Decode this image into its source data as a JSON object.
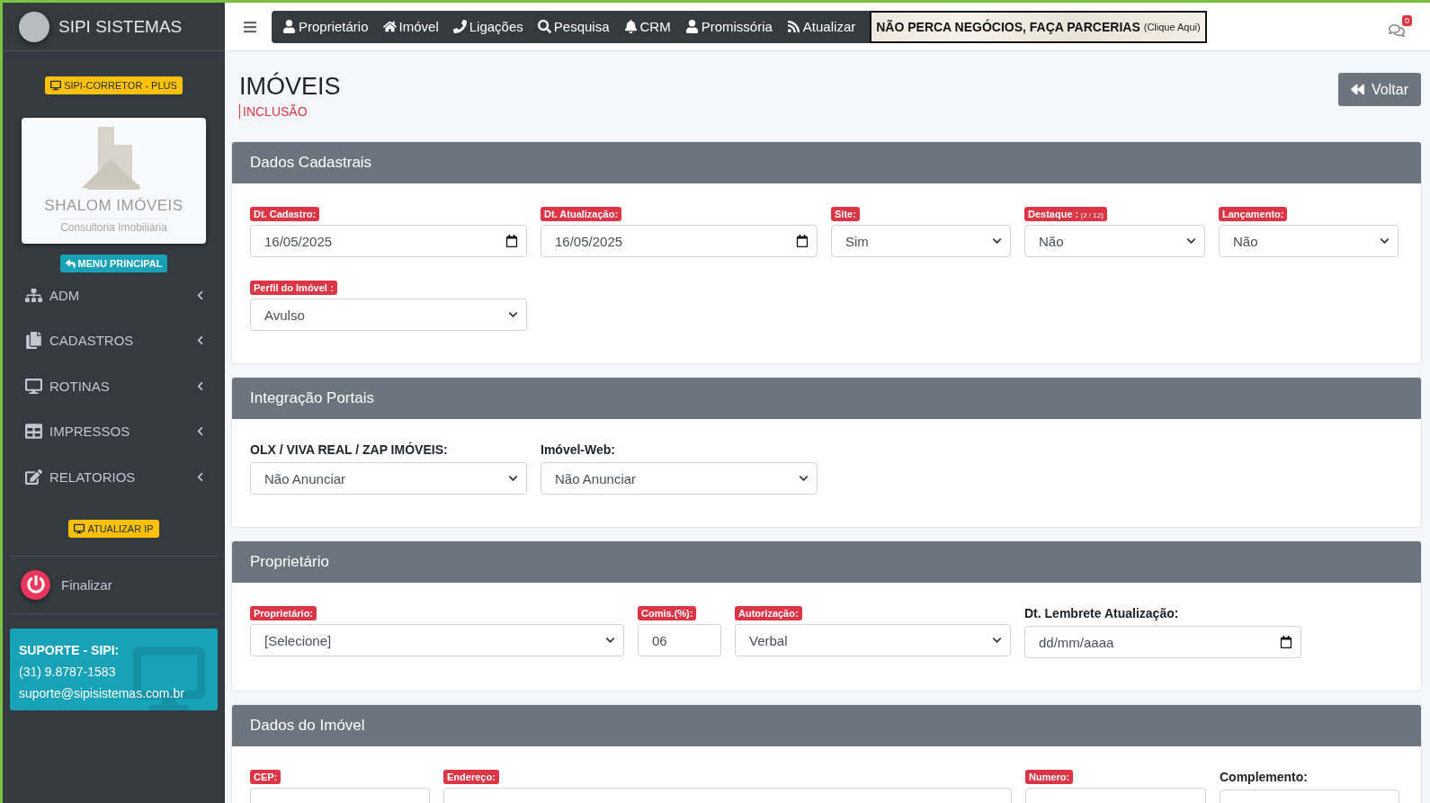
{
  "sidebar": {
    "brand": "SIPI SISTEMAS",
    "plan_badge": "SIPI-CORRETOR - PLUS",
    "logo": {
      "title": "SHALOM IMÓVEIS",
      "subtitle": "Consultoria Imobiliária"
    },
    "menu_button": "MENU PRINCIPAL",
    "items": [
      {
        "label": "ADM"
      },
      {
        "label": "CADASTROS"
      },
      {
        "label": "ROTINAS"
      },
      {
        "label": "IMPRESSOS"
      },
      {
        "label": "RELATORIOS"
      }
    ],
    "update_ip": "ATUALIZAR IP",
    "logout": "Finalizar",
    "support": {
      "title": "SUPORTE - SIPI:",
      "phone": "(31) 9.8787-1583",
      "email": "suporte@sipisistemas.com.br"
    }
  },
  "topnav": {
    "items": [
      {
        "label": "Proprietário"
      },
      {
        "label": "Imóvel"
      },
      {
        "label": "Ligações"
      },
      {
        "label": "Pesquisa"
      },
      {
        "label": "CRM"
      },
      {
        "label": "Promissória"
      },
      {
        "label": "Atualizar"
      }
    ],
    "banner": {
      "text": "NÃO PERCA NEGÓCIOS, FAÇA PARCERIAS",
      "hint": "(Clique Aqui)"
    },
    "notifications": "0"
  },
  "page": {
    "title": "IMÓVEIS",
    "subtitle": "INCLUSÃO",
    "back_button": "Voltar"
  },
  "sections": [
    {
      "title": "Dados Cadastrais",
      "rows": [
        [
          {
            "label": "Dt. Cadastro:",
            "required": true,
            "kind": "date",
            "value": "16/05/2025"
          },
          {
            "label": "Dt. Atualização:",
            "required": true,
            "kind": "date",
            "value": "16/05/2025"
          },
          {
            "label": "Site:",
            "required": true,
            "kind": "select",
            "value": "Sim"
          },
          {
            "label": "Destaque :",
            "note": "(2 / 12)",
            "required": true,
            "kind": "select",
            "value": "Não"
          },
          {
            "label": "Lançamento:",
            "required": true,
            "kind": "select",
            "value": "Não"
          }
        ],
        [
          {
            "label": "Perfil do Imóvel :",
            "required": true,
            "kind": "select",
            "value": "Avulso"
          }
        ]
      ]
    },
    {
      "title": "Integração Portais",
      "rows": [
        [
          {
            "label": "OLX / VIVA REAL / ZAP IMÓVEIS:",
            "required": false,
            "kind": "select",
            "value": "Não Anunciar"
          },
          {
            "label": "Imóvel-Web:",
            "required": false,
            "kind": "select",
            "value": "Não Anunciar"
          }
        ]
      ]
    },
    {
      "title": "Proprietário",
      "rows": [
        [
          {
            "label": "Proprietário:",
            "required": true,
            "kind": "select",
            "value": "[Selecione]"
          },
          {
            "label": "Comis.(%):",
            "required": true,
            "kind": "text",
            "value": "06"
          },
          {
            "label": "Autorização:",
            "required": true,
            "kind": "select",
            "value": "Verbal"
          },
          {
            "label": "Dt. Lembrete Atualização:",
            "required": false,
            "kind": "date",
            "placeholder": "dd/mm/aaaa"
          }
        ]
      ]
    },
    {
      "title": "Dados do Imóvel",
      "rows": [
        [
          {
            "label": "CEP:",
            "required": true,
            "kind": "text"
          },
          {
            "label": "Endereço:",
            "required": true,
            "kind": "text"
          },
          {
            "label": "Numero:",
            "required": true,
            "kind": "text"
          },
          {
            "label": "Complemento:",
            "required": false,
            "kind": "text"
          }
        ]
      ]
    }
  ]
}
